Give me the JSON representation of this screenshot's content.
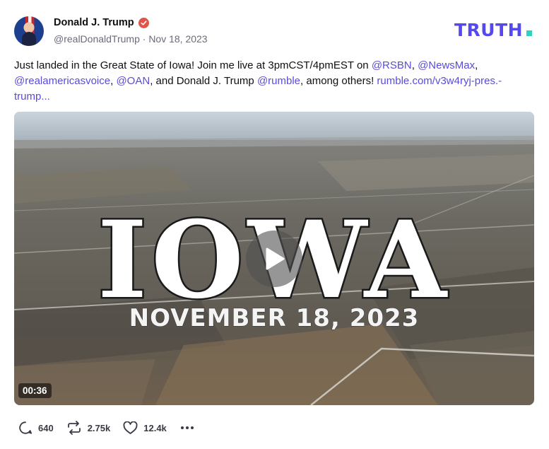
{
  "author": {
    "display_name": "Donald J. Trump",
    "handle": "@realDonaldTrump",
    "separator": "·",
    "date": "Nov 18, 2023",
    "avatar_icon": "avatar-photo",
    "verified_icon": "verified-badge-icon",
    "verified_color": "#e0554a"
  },
  "brand": {
    "logo_text": "TRUTH",
    "logo_dot": ".",
    "logo_color": "#5448ee",
    "dot_color": "#2bd4bd"
  },
  "post": {
    "text_1": "Just landed in the Great State of Iowa! Join me live at 3pmCST/4pmEST on ",
    "mention_rsbn": "@RSBN",
    "sep_1": ", ",
    "mention_newsmax": "@NewsMax",
    "sep_2": ", ",
    "mention_rav": "@realamericasvoice",
    "sep_3": ", ",
    "mention_oan": "@OAN",
    "text_2": ", and Donald J. Trump ",
    "mention_rumble": "@rumble",
    "text_3": ", among others! ",
    "link_text": "rumble.com/v3w4ryj-pres.-trump...",
    "mention_color": "#5a4cd6"
  },
  "media": {
    "overlay_title": "IOWA",
    "overlay_date": "NOVEMBER 18, 2023",
    "duration": "00:36",
    "play_icon": "play-icon"
  },
  "actions": {
    "replies": "640",
    "reposts": "2.75k",
    "likes": "12.4k",
    "reply_icon": "reply-icon",
    "repost_icon": "repost-icon",
    "like_icon": "heart-icon",
    "more_icon": "more-dots-icon"
  }
}
